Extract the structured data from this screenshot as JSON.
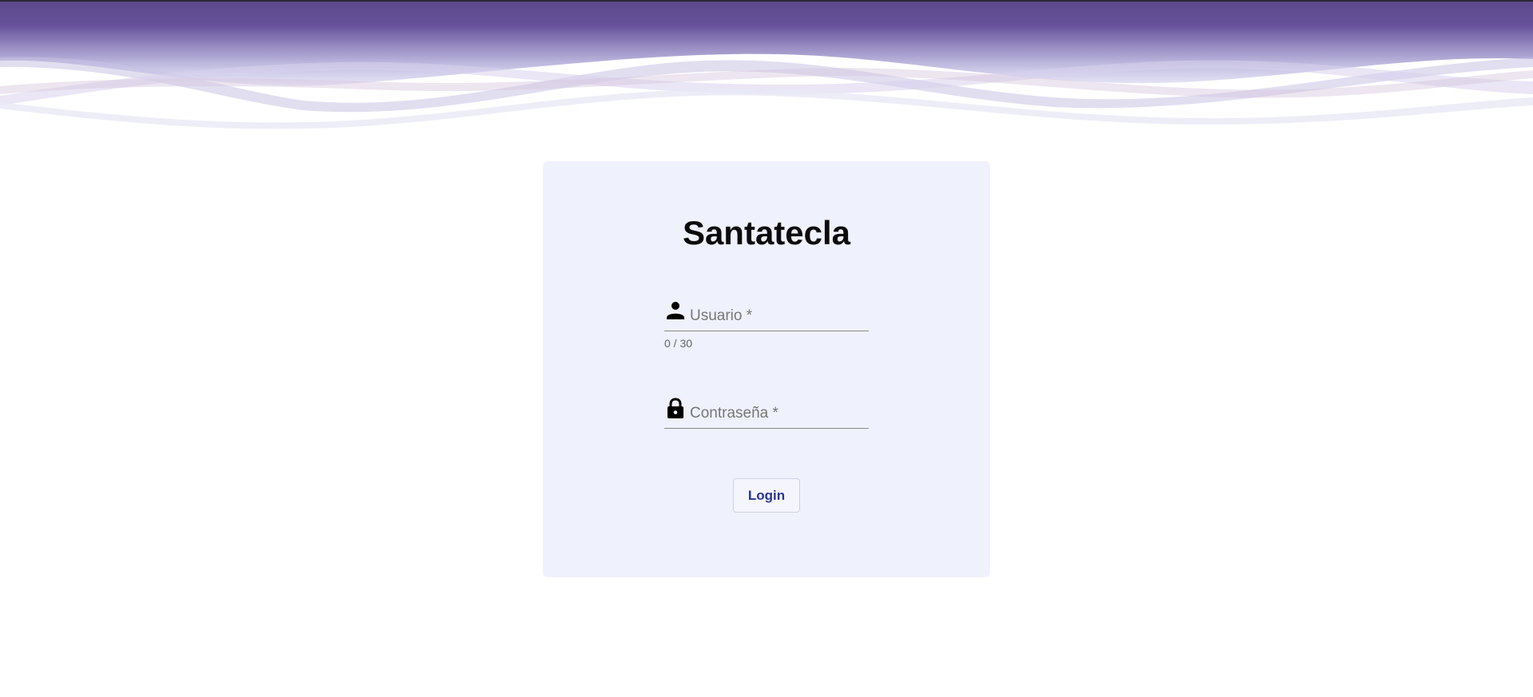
{
  "login": {
    "title": "Santatecla",
    "username": {
      "placeholder": "Usuario *",
      "value": "",
      "counter": "0 / 30",
      "icon": "person-icon"
    },
    "password": {
      "placeholder": "Contraseña *",
      "value": "",
      "icon": "lock-icon"
    },
    "login_label": "Login"
  },
  "colors": {
    "header_purple": "#62508f",
    "card_background": "#eff1fd",
    "button_text": "#2b3594"
  }
}
